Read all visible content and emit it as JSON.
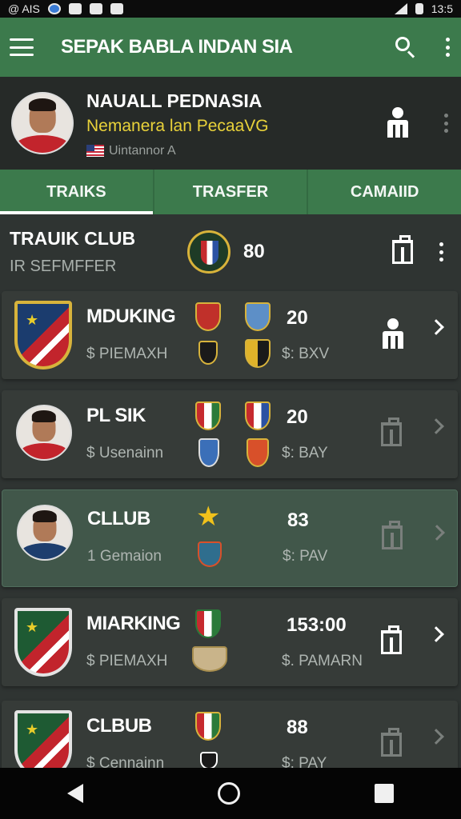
{
  "status_bar": {
    "left_text": "@ AIS",
    "time": "13:5"
  },
  "app_bar": {
    "title": "SEPAK BABLA INDAN SIA",
    "icons": [
      "menu-icon",
      "search-icon",
      "more-vert-icon"
    ]
  },
  "profile": {
    "name": "NAUALL PEDNASIA",
    "subtitle": "Nemanera lan PecaaVG",
    "country": "Uintannor A"
  },
  "tabs": [
    {
      "label": "TRAIKS",
      "active": true
    },
    {
      "label": "TRASFER",
      "active": false
    },
    {
      "label": "CAMAIID",
      "active": false
    }
  ],
  "section": {
    "title": "TRAUIK CLUB",
    "subtitle": "IR SEFMFFER",
    "value": "80"
  },
  "cards": [
    {
      "name": "MDUKING",
      "sub": "$ PIEMAXH",
      "value": "20",
      "currency": "$: BXV"
    },
    {
      "name": "PL SIK",
      "sub": "$ Usenainn",
      "value": "20",
      "currency": "$: BAY"
    },
    {
      "name": "CLLUB",
      "sub": "1 Gemaion",
      "value": "83",
      "currency": "$: PAV"
    },
    {
      "name": "MIARKING",
      "sub": "$ PIEMAXH",
      "value": "153:00",
      "currency": "$. PAMARN"
    },
    {
      "name": "CLBUB",
      "sub": "$ Cennainn",
      "value": "88",
      "currency": "$: PAY"
    }
  ],
  "colors": {
    "primary_green": "#3c7a4c",
    "background": "#2f3432",
    "card": "#363b38",
    "highlight_card": "#41574a",
    "accent_yellow": "#e9d23a"
  }
}
